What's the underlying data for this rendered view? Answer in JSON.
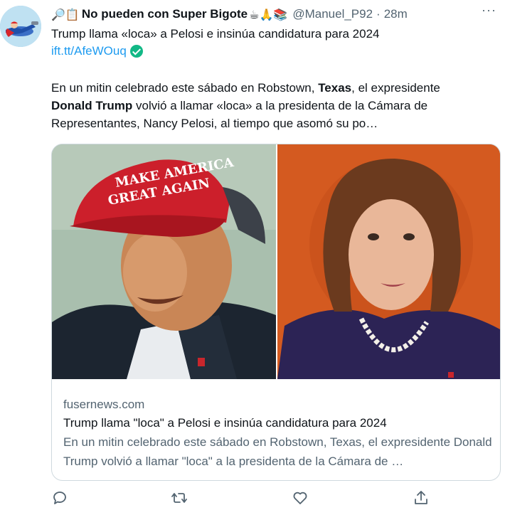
{
  "tweet": {
    "display_name": "No pueden con Super Bigote",
    "name_prefix_emoji": "🔎📋",
    "name_suffix_emoji": "☕🙏📚",
    "handle": "@Manuel_P92",
    "separator": "·",
    "time": "28m",
    "more_label": "···",
    "headline": "Trump llama «loca» a Pelosi e insinúa candidatura para 2024",
    "link": "ift.tt/AfeWOuq",
    "body": {
      "part1": "En un mitin celebrado este sábado en Robstown, ",
      "bold1": "Texas",
      "part2": ", el expresidente ",
      "bold2": "Donald Trump",
      "part3": " volvió a llamar «loca» a la presidenta de la Cámara de Representantes, Nancy Pelosi, al tiempo que asomó su po…"
    }
  },
  "card": {
    "domain": "fusernews.com",
    "title": "Trump llama \"loca\" a Pelosi e insinúa candidatura para 2024",
    "description": "En un mitin celebrado este sábado en Robstown, Texas, el expresidente Donald Trump volvió a llamar \"loca\" a la presidenta de la Cámara de …",
    "left_image_alt": "Donald Trump",
    "right_image_alt": "Nancy Pelosi",
    "cap_text_line1": "MAKE AMERICA",
    "cap_text_line2": "GREAT AGAIN"
  },
  "actions": {
    "icons": [
      "reply-icon",
      "retweet-icon",
      "like-icon",
      "share-icon"
    ]
  },
  "colors": {
    "link": "#1d9bf0",
    "secondary_text": "#536471",
    "verified_badge": "#12b886",
    "border": "#cfd9de"
  }
}
